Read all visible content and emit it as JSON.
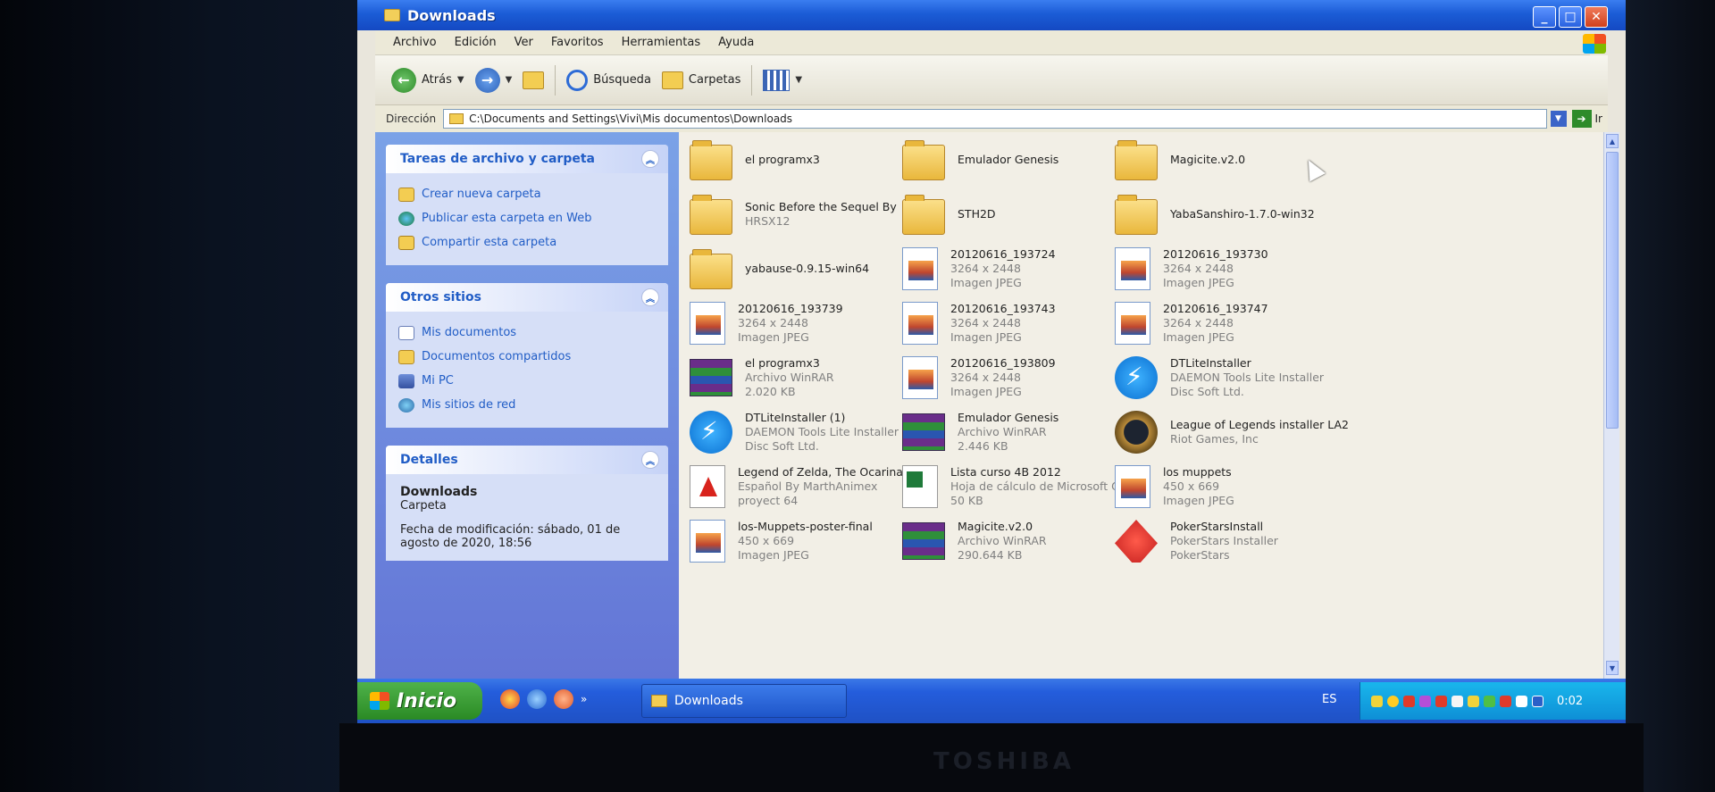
{
  "window": {
    "title": "Downloads",
    "buttons": {
      "minimize": "_",
      "maximize": "□",
      "close": "✕"
    }
  },
  "menu": [
    "Archivo",
    "Edición",
    "Ver",
    "Favoritos",
    "Herramientas",
    "Ayuda"
  ],
  "toolbar": {
    "back_label": "Atrás",
    "search_label": "Búsqueda",
    "folders_label": "Carpetas"
  },
  "address": {
    "label": "Dirección",
    "path": "C:\\Documents and Settings\\Vivi\\Mis documentos\\Downloads",
    "go_label": "Ir"
  },
  "taskpane": {
    "file_tasks": {
      "title": "Tareas de archivo y carpeta",
      "items": [
        "Crear nueva carpeta",
        "Publicar esta carpeta en Web",
        "Compartir esta carpeta"
      ]
    },
    "other_places": {
      "title": "Otros sitios",
      "items": [
        "Mis documentos",
        "Documentos compartidos",
        "Mi PC",
        "Mis sitios de red"
      ]
    },
    "details": {
      "title": "Detalles",
      "name": "Downloads",
      "type": "Carpeta",
      "modified": "Fecha de modificación: sábado, 01 de agosto de 2020, 18:56"
    }
  },
  "files": [
    {
      "name": "el programx3",
      "l2": "",
      "l3": "",
      "icon": "folder-icon"
    },
    {
      "name": "Emulador Genesis",
      "l2": "",
      "l3": "",
      "icon": "folder-icon"
    },
    {
      "name": "Magicite.v2.0",
      "l2": "",
      "l3": "",
      "icon": "folder-icon"
    },
    {
      "name": "Sonic Before the Sequel By",
      "l2": "HRSX12",
      "l3": "",
      "icon": "folder-icon"
    },
    {
      "name": "STH2D",
      "l2": "",
      "l3": "",
      "icon": "folder-icon"
    },
    {
      "name": "YabaSanshiro-1.7.0-win32",
      "l2": "",
      "l3": "",
      "icon": "folder-icon"
    },
    {
      "name": "yabause-0.9.15-win64",
      "l2": "",
      "l3": "",
      "icon": "folder-icon"
    },
    {
      "name": "20120616_193724",
      "l2": "3264 x 2448",
      "l3": "Imagen JPEG",
      "icon": "jpeg-icon"
    },
    {
      "name": "20120616_193730",
      "l2": "3264 x 2448",
      "l3": "Imagen JPEG",
      "icon": "jpeg-icon"
    },
    {
      "name": "20120616_193739",
      "l2": "3264 x 2448",
      "l3": "Imagen JPEG",
      "icon": "jpeg-icon"
    },
    {
      "name": "20120616_193743",
      "l2": "3264 x 2448",
      "l3": "Imagen JPEG",
      "icon": "jpeg-icon"
    },
    {
      "name": "20120616_193747",
      "l2": "3264 x 2448",
      "l3": "Imagen JPEG",
      "icon": "jpeg-icon"
    },
    {
      "name": "el programx3",
      "l2": "Archivo WinRAR",
      "l3": "2.020 KB",
      "icon": "winrar-icon"
    },
    {
      "name": "20120616_193809",
      "l2": "3264 x 2448",
      "l3": "Imagen JPEG",
      "icon": "jpeg-icon"
    },
    {
      "name": "DTLiteInstaller",
      "l2": "DAEMON Tools Lite Installer",
      "l3": "Disc Soft Ltd.",
      "icon": "daemon-tools-icon"
    },
    {
      "name": "DTLiteInstaller (1)",
      "l2": "DAEMON Tools Lite Installer",
      "l3": "Disc Soft Ltd.",
      "icon": "daemon-tools-icon"
    },
    {
      "name": "Emulador Genesis",
      "l2": "Archivo WinRAR",
      "l3": "2.446 KB",
      "icon": "winrar-icon"
    },
    {
      "name": "League of Legends installer LA2",
      "l2": "Riot Games, Inc",
      "l3": "",
      "icon": "league-icon"
    },
    {
      "name": "Legend of Zelda, The Ocarina of",
      "l2": "Español By MarthAnimex",
      "l3": "proyect 64",
      "icon": "pdf-icon"
    },
    {
      "name": "Lista curso 4B 2012",
      "l2": "Hoja de cálculo de Microsoft O...",
      "l3": "50 KB",
      "icon": "excel-icon"
    },
    {
      "name": "los muppets",
      "l2": "450 x 669",
      "l3": "Imagen JPEG",
      "icon": "jpeg-icon"
    },
    {
      "name": "los-Muppets-poster-final",
      "l2": "450 x 669",
      "l3": "Imagen JPEG",
      "icon": "jpeg-icon"
    },
    {
      "name": "Magicite.v2.0",
      "l2": "Archivo WinRAR",
      "l3": "290.644 KB",
      "icon": "winrar-icon"
    },
    {
      "name": "PokerStarsInstall",
      "l2": "PokerStars Installer",
      "l3": "PokerStars",
      "icon": "pokerstars-icon"
    }
  ],
  "taskbar": {
    "start_label": "Inicio",
    "window_button": "Downloads",
    "language": "ES",
    "clock": "0:02"
  },
  "bezel_brand": "TOSHIBA"
}
